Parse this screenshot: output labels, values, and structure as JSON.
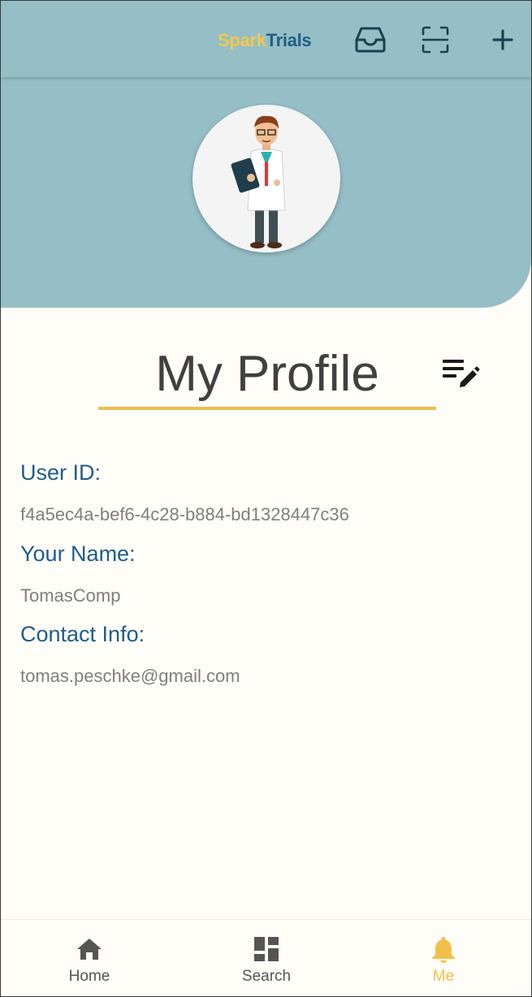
{
  "header": {
    "brand_part1": "Spark",
    "brand_part2": "Trials",
    "icons": [
      "inbox-icon",
      "scan-icon",
      "add-icon"
    ]
  },
  "profile": {
    "title": "My Profile",
    "fields": [
      {
        "label": "User ID:",
        "value": "f4a5ec4a-bef6-4c28-b884-bd1328447c36"
      },
      {
        "label": "Your Name:",
        "value": "TomasComp"
      },
      {
        "label": "Contact Info:",
        "value": "tomas.peschke@gmail.com"
      }
    ]
  },
  "bottom_nav": {
    "items": [
      {
        "label": "Home",
        "icon": "home-icon",
        "active": false
      },
      {
        "label": "Search",
        "icon": "dashboard-icon",
        "active": false
      },
      {
        "label": "Me",
        "icon": "bell-icon",
        "active": true
      }
    ]
  },
  "colors": {
    "header_bg": "#95bec6",
    "brand_yellow": "#f2c94c",
    "brand_blue": "#1f5e87",
    "accent_underline": "#e8c050",
    "active_nav": "#f2c04a"
  }
}
